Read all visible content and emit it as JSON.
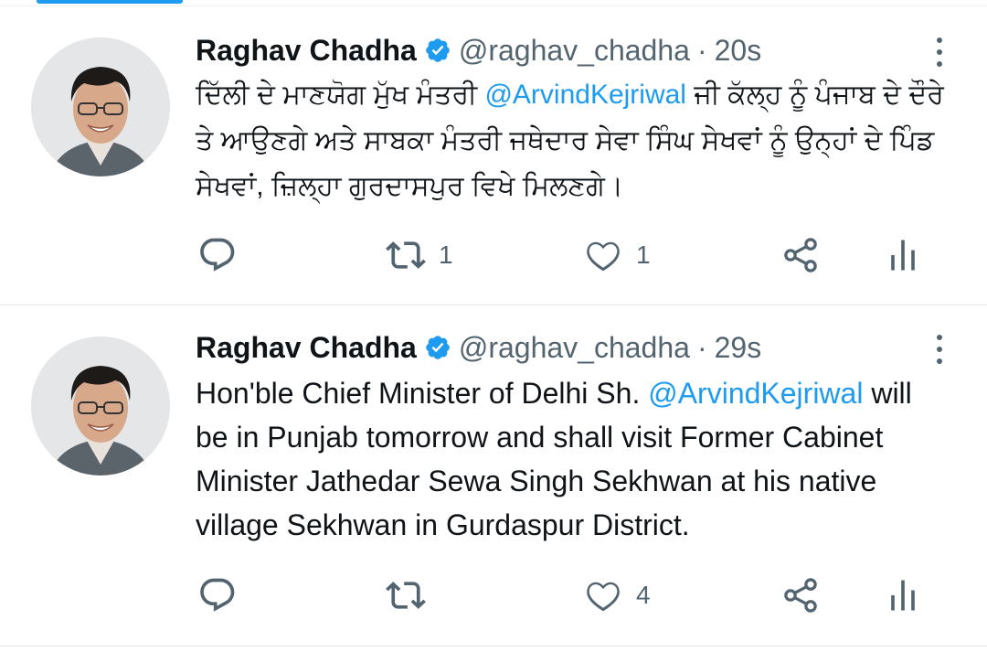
{
  "tweets": [
    {
      "author_name": "Raghav Chadha",
      "handle": "@raghav_chadha",
      "separator": "·",
      "time": "20s",
      "text_parts": [
        "ਦਿੱਲੀ ਦੇ ਮਾਣਯੋਗ ਮੁੱਖ ਮੰਤਰੀ ",
        "@ArvindKejriwal",
        " ਜੀ ਕੱਲ੍ਹ ਨੂੰ ਪੰਜਾਬ ਦੇ ਦੌਰੇ ਤੇ ਆਉਣਗੇ ਅਤੇ ਸਾਬਕਾ ਮੰਤਰੀ ਜਥੇਦਾਰ ਸੇਵਾ ਸਿੰਘ ਸੇਖਵਾਂ ਨੂੰ ਉਨ੍ਹਾਂ ਦੇ ਪਿੰਡ ਸੇਖਵਾਂ, ਜ਼ਿਲ੍ਹਾ ਗੁਰਦਾਸਪੁਰ ਵਿਖੇ ਮਿਲਣਗੇ।"
      ],
      "reply_count": "",
      "retweet_count": "1",
      "like_count": "1"
    },
    {
      "author_name": "Raghav Chadha",
      "handle": "@raghav_chadha",
      "separator": "·",
      "time": "29s",
      "text_parts": [
        "Hon'ble Chief Minister of Delhi Sh. ",
        "@ArvindKejriwal",
        " will be in Punjab tomorrow and shall visit Former Cabinet Minister Jathedar Sewa Singh Sekhwan at his native village Sekhwan in Gurdaspur District."
      ],
      "reply_count": "",
      "retweet_count": "",
      "like_count": "4"
    }
  ],
  "icons": {
    "verified": "verified-badge-icon",
    "more": "more-vertical-icon",
    "reply": "reply-icon",
    "retweet": "retweet-icon",
    "like": "heart-icon",
    "share": "share-icon",
    "analytics": "analytics-icon"
  },
  "colors": {
    "accent": "#1d9bf0",
    "secondary_text": "#536471",
    "primary_text": "#0f1419",
    "divider": "#e3e7e9"
  }
}
